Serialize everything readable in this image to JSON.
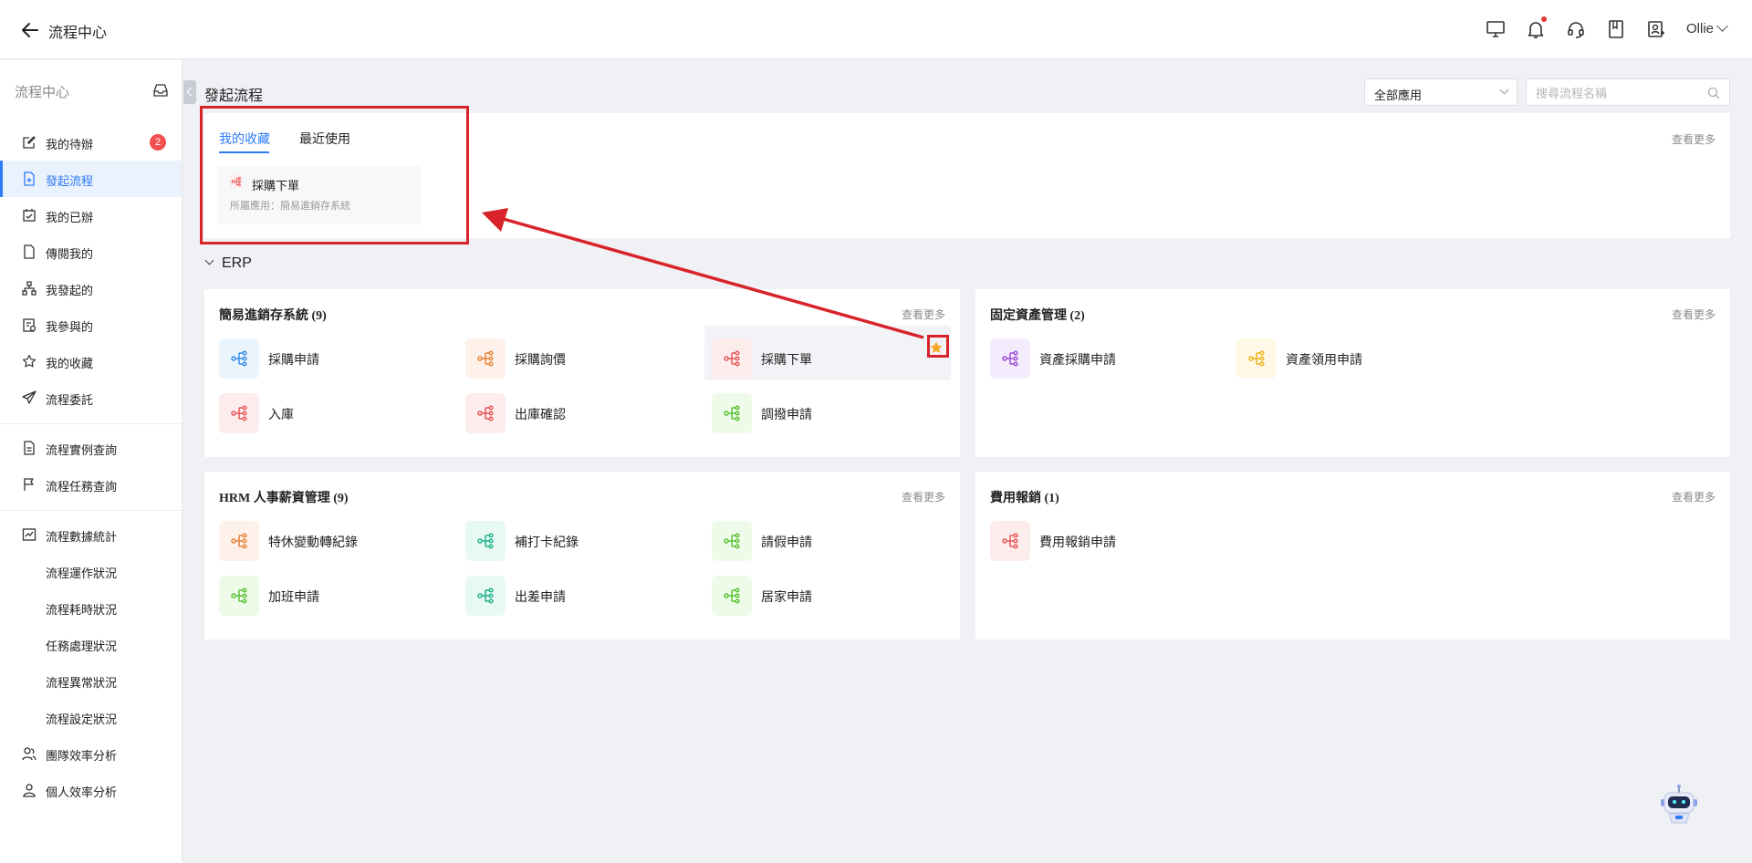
{
  "header": {
    "title": "流程中心",
    "user": "Ollie"
  },
  "sidebar": {
    "heading": "流程中心",
    "items": [
      {
        "label": "我的待辦",
        "badge": "2"
      },
      {
        "label": "發起流程"
      },
      {
        "label": "我的已辦"
      },
      {
        "label": "傳閱我的"
      },
      {
        "label": "我發起的"
      },
      {
        "label": "我參與的"
      },
      {
        "label": "我的收藏"
      },
      {
        "label": "流程委託"
      },
      {
        "label": "流程實例查詢"
      },
      {
        "label": "流程任務查詢"
      },
      {
        "label": "流程數據統計"
      },
      {
        "label": "流程運作狀況"
      },
      {
        "label": "流程耗時狀況"
      },
      {
        "label": "任務處理狀況"
      },
      {
        "label": "流程異常狀況"
      },
      {
        "label": "流程設定狀況"
      },
      {
        "label": "團隊效率分析"
      },
      {
        "label": "個人效率分析"
      }
    ]
  },
  "main": {
    "title": "發起流程",
    "app_filter": "全部應用",
    "search_placeholder": "搜尋流程名稱",
    "more_label": "查看更多",
    "tabs": [
      "我的收藏",
      "最近使用"
    ],
    "favorite": {
      "name": "採購下單",
      "subtitle": "所屬應用：簡易進銷存系統"
    },
    "group": "ERP",
    "panels": [
      {
        "title": "簡易進銷存系統 (9)",
        "flows": [
          "採購申請",
          "採購詢價",
          "採購下單",
          "入庫",
          "出庫確認",
          "調撥申請"
        ]
      },
      {
        "title": "固定資產管理 (2)",
        "flows": [
          "資產採購申請",
          "資產領用申請"
        ]
      },
      {
        "title": "HRM 人事薪資管理 (9)",
        "flows": [
          "特休變動轉紀錄",
          "補打卡紀錄",
          "請假申請",
          "加班申請",
          "出差申請",
          "居家申請"
        ]
      },
      {
        "title": "費用報銷 (1)",
        "flows": [
          "費用報銷申請"
        ]
      }
    ]
  },
  "colors": {
    "accent": "#2f7cf6",
    "annotation": "#d8232a",
    "badge": "#f25050",
    "star": "#f5a623"
  }
}
